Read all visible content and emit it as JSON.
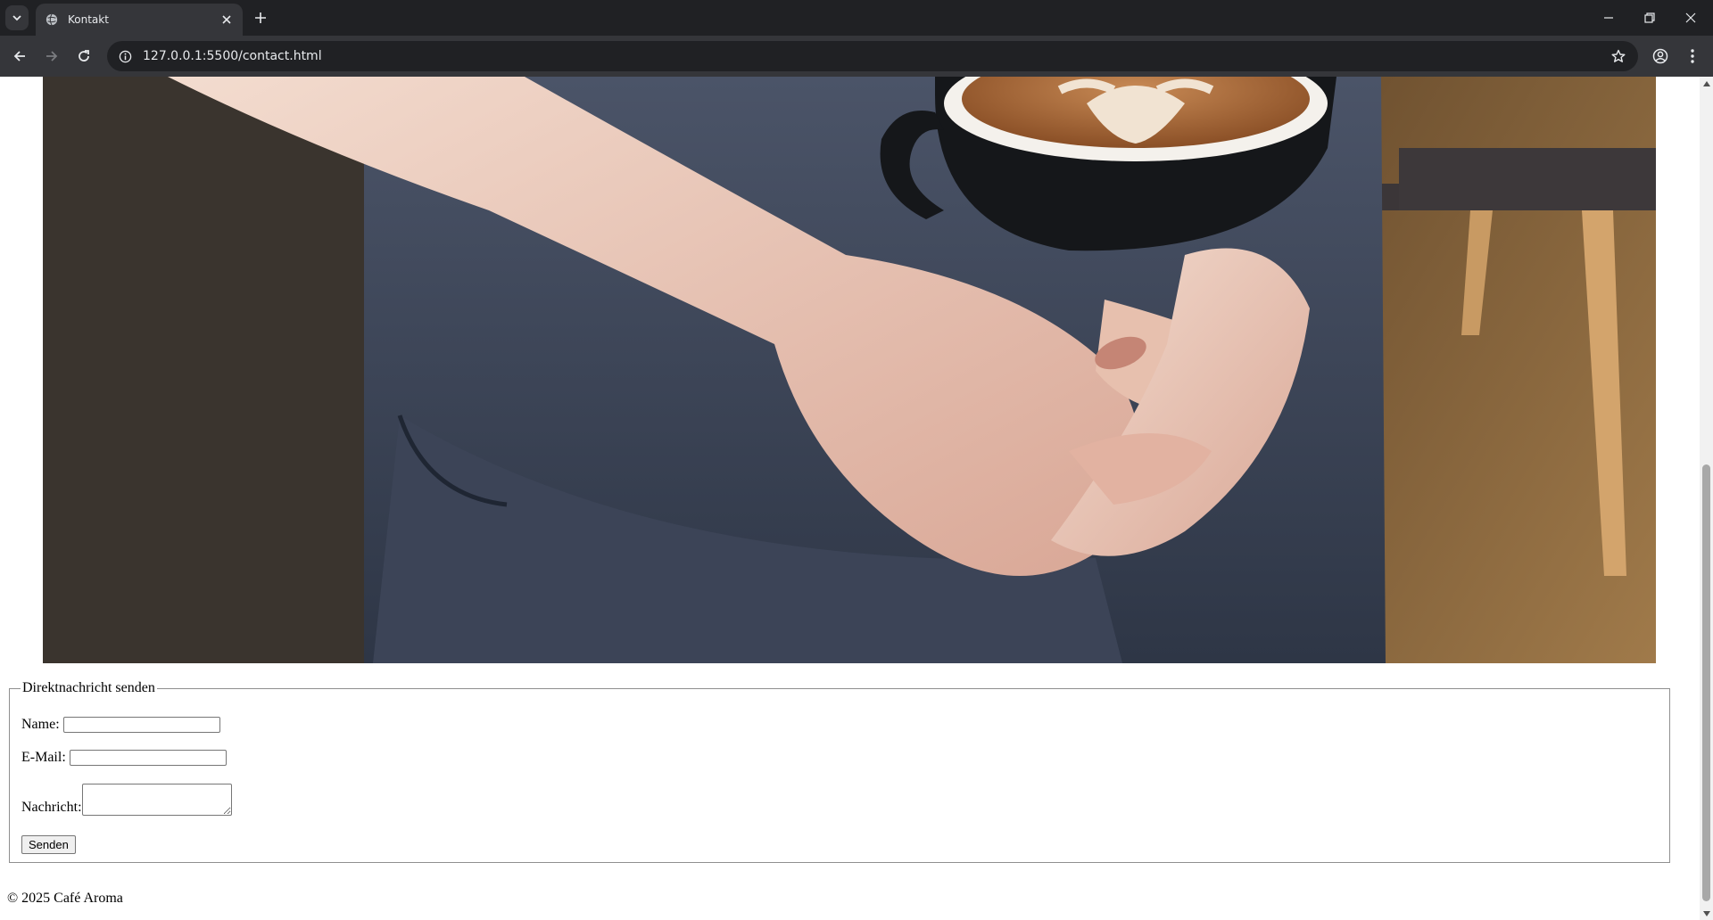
{
  "browser": {
    "tab_title": "Kontakt",
    "url": "127.0.0.1:5500/contact.html",
    "icons": {
      "tab_list": "chevron-down-icon",
      "favicon": "globe-icon",
      "close_tab": "close-icon",
      "new_tab": "plus-icon",
      "back": "arrow-left-icon",
      "forward": "arrow-right-icon",
      "reload": "reload-icon",
      "site_info": "info-icon",
      "bookmark": "star-icon",
      "profile": "profile-icon",
      "menu": "kebab-menu-icon"
    }
  },
  "page": {
    "hero_image": {
      "kind": "photo",
      "depicts": "hands holding a latte cup in front of a dark apron"
    },
    "form": {
      "legend": "Direktnachricht senden",
      "name_label": "Name:",
      "name_value": "",
      "email_label": "E-Mail:",
      "email_value": "",
      "message_label": "Nachricht:",
      "message_value": "",
      "submit_label": "Senden"
    },
    "footer": "© 2025 Café Aroma"
  },
  "scrollbar": {
    "scroll_fraction": 0.55
  }
}
